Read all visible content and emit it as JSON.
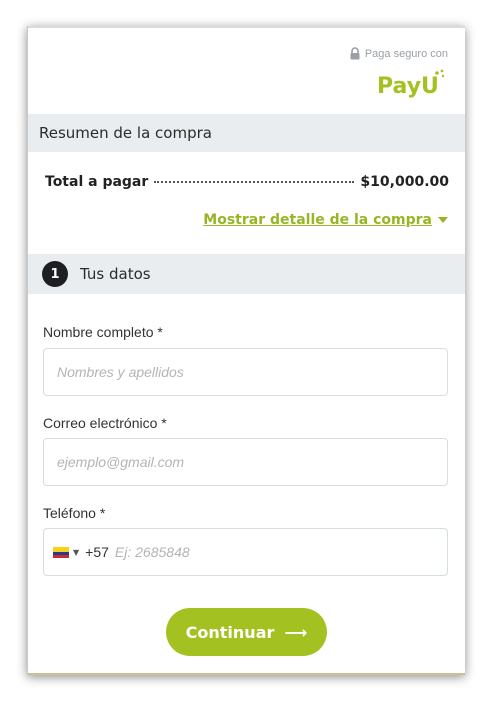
{
  "secure_badge": {
    "text": "Paga seguro con",
    "icon": "lock-icon"
  },
  "brand": {
    "logo_text": "PayU",
    "accent": "#a3c221"
  },
  "summary": {
    "title": "Resumen de la compra",
    "total_label": "Total a pagar",
    "total_amount": "$10,000.00",
    "detail_link": "Mostrar detalle de la compra",
    "detail_icon": "caret-down-icon"
  },
  "step": {
    "number": "1",
    "title": "Tus datos"
  },
  "form": {
    "name": {
      "label": "Nombre completo *",
      "placeholder": "Nombres y apellidos"
    },
    "email": {
      "label": "Correo electrónico *",
      "placeholder": "ejemplo@gmail.com"
    },
    "phone": {
      "label": "Teléfono *",
      "country_code": "+57",
      "placeholder": "Ej: 2685848",
      "flag": "colombia-flag-icon"
    }
  },
  "continue_button": {
    "label": "Continuar",
    "icon": "arrow-right-icon"
  }
}
